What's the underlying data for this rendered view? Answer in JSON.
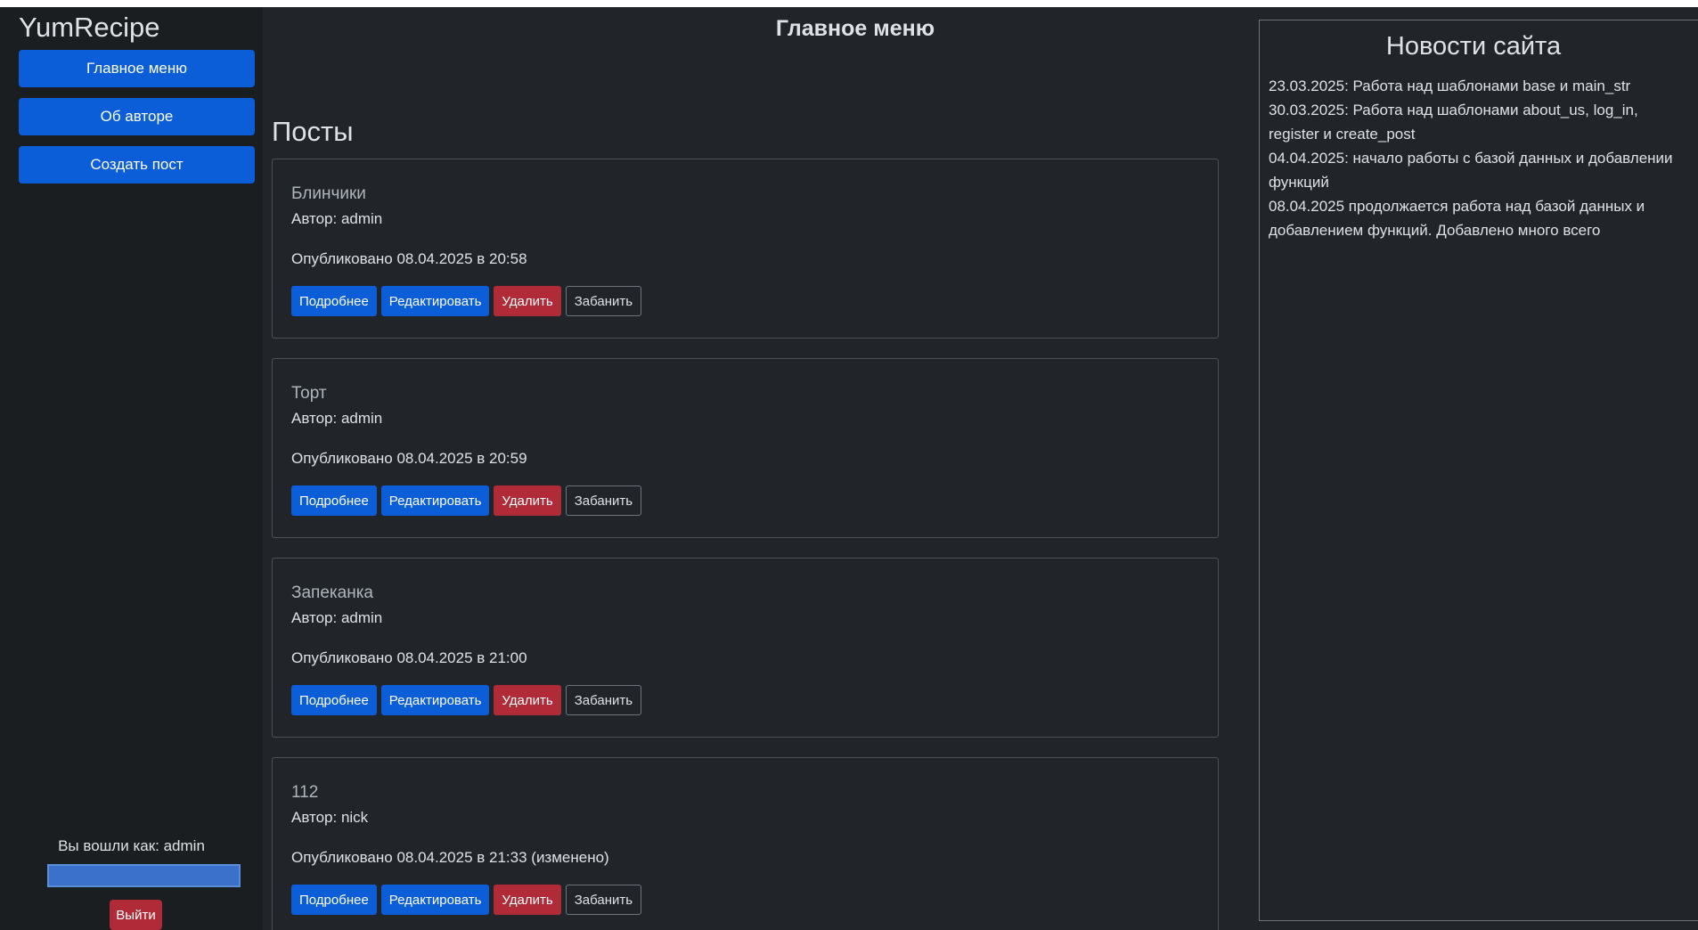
{
  "sidebar": {
    "brand": "YumRecipe",
    "nav": [
      {
        "label": "Главное меню"
      },
      {
        "label": "Об авторе"
      },
      {
        "label": "Создать пост"
      }
    ],
    "user_text": "Вы вошли как: admin",
    "logout_label": "Выйти"
  },
  "main": {
    "page_title": "Главное меню",
    "section_title": "Посты",
    "posts": [
      {
        "title": "Блинчики",
        "author": "Автор: admin",
        "date": "Опубликовано 08.04.2025 в 20:58"
      },
      {
        "title": "Торт",
        "author": "Автор: admin",
        "date": "Опубликовано 08.04.2025 в 20:59"
      },
      {
        "title": "Запеканка",
        "author": "Автор: admin",
        "date": "Опубликовано 08.04.2025 в 21:00"
      },
      {
        "title": "112",
        "author": "Автор: nick",
        "date": "Опубликовано 08.04.2025 в 21:33 (изменено)"
      }
    ],
    "buttons": {
      "details": "Подробнее",
      "edit": "Редактировать",
      "delete": "Удалить",
      "ban": "Забанить"
    }
  },
  "news": {
    "title": "Новости сайта",
    "items": [
      "23.03.2025: Работа над шаблонами base и main_str",
      "30.03.2025: Работа над шаблонами about_us, log_in, register и create_post",
      "04.04.2025: начало работы с базой данных и добавлении функций",
      "08.04.2025 продолжается работа над базой данных и добавлением функций. Добавлено много всего"
    ]
  },
  "colors": {
    "background": "#212529",
    "sidebar": "#1b1e21",
    "primary": "#0b5ed7",
    "danger": "#b02a37"
  }
}
